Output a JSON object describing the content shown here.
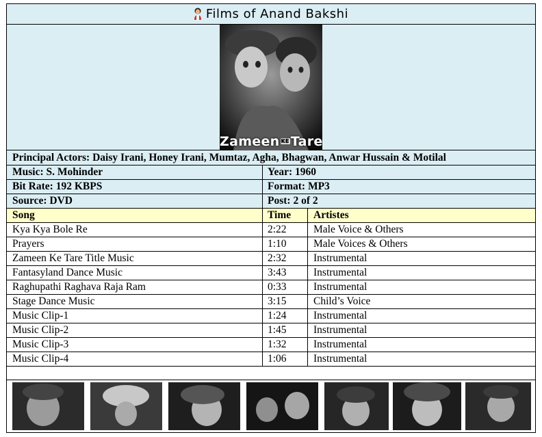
{
  "title": "Films of Anand Bakshi",
  "poster": {
    "film_title_part1": "Zameen",
    "film_title_ke": "KE",
    "film_title_part2": "Tare"
  },
  "actors": "Principal Actors: Daisy Irani, Honey Irani, Mumtaz, Agha, Bhagwan, Anwar Hussain & Motilal",
  "info": [
    {
      "left": "Music: S. Mohinder",
      "right": "Year: 1960"
    },
    {
      "left": "Bit Rate: 192 KBPS",
      "right": "Format: MP3"
    },
    {
      "left": "Source: DVD",
      "right": "Post: 2 of 2"
    }
  ],
  "table": {
    "headers": {
      "song": "Song",
      "time": "Time",
      "artistes": "Artistes"
    },
    "rows": [
      {
        "song": "Kya Kya Bole Re",
        "time": "2:22",
        "artistes": "Male Voice & Others"
      },
      {
        "song": "Prayers",
        "time": "1:10",
        "artistes": "Male Voices & Others"
      },
      {
        "song": "Zameen Ke Tare Title Music",
        "time": "2:32",
        "artistes": "Instrumental"
      },
      {
        "song": "Fantasyland Dance Music",
        "time": "3:43",
        "artistes": "Instrumental"
      },
      {
        "song": "Raghupathi Raghava Raja Ram",
        "time": "0:33",
        "artistes": "Instrumental"
      },
      {
        "song": "Stage Dance Music",
        "time": "3:15",
        "artistes": "Child’s Voice"
      },
      {
        "song": "Music Clip-1",
        "time": "1:24",
        "artistes": "Instrumental"
      },
      {
        "song": "Music Clip-2",
        "time": "1:45",
        "artistes": "Instrumental"
      },
      {
        "song": "Music Clip-3",
        "time": "1:32",
        "artistes": "Instrumental"
      },
      {
        "song": "Music Clip-4",
        "time": "1:06",
        "artistes": "Instrumental"
      }
    ]
  },
  "colors": {
    "header_bg": "#dbeef4",
    "table_header_bg": "#ffffcc",
    "border": "#000000"
  }
}
